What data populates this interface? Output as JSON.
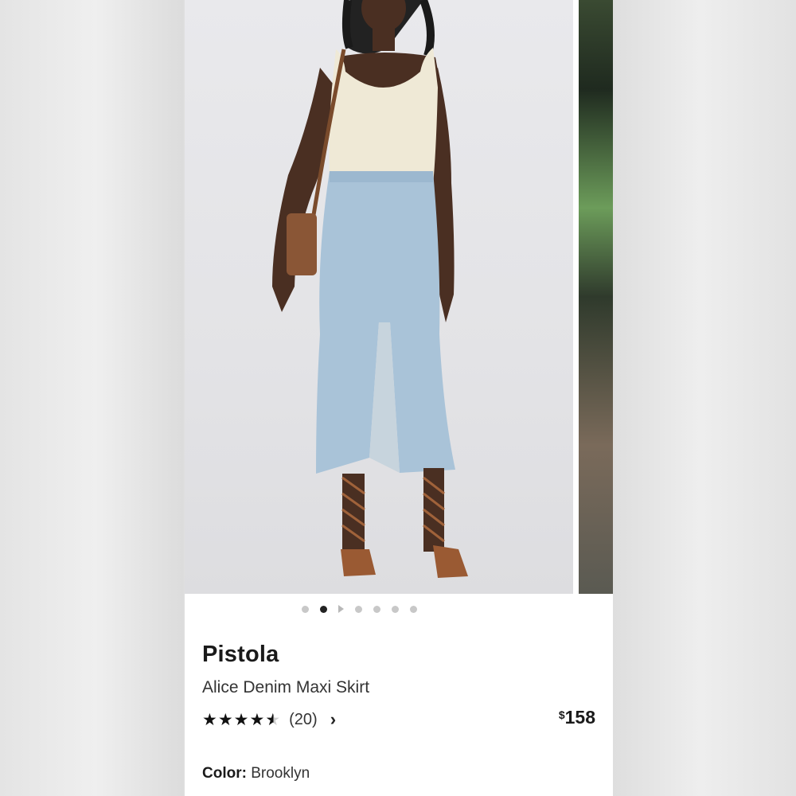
{
  "gallery": {
    "images": [
      "model-wearing-skirt-photo",
      "model-detail-photo"
    ],
    "dots_total": 6,
    "dots_active_index": 1
  },
  "product": {
    "brand": "Pistola",
    "name": "Alice Denim Maxi Skirt",
    "rating": 4.5,
    "review_count": "(20)",
    "price_symbol": "$",
    "price_amount": "158",
    "color_label": "Color:",
    "color_value": "Brooklyn"
  },
  "icons": {
    "chevron": "chevron-right-icon",
    "play": "play-icon"
  }
}
